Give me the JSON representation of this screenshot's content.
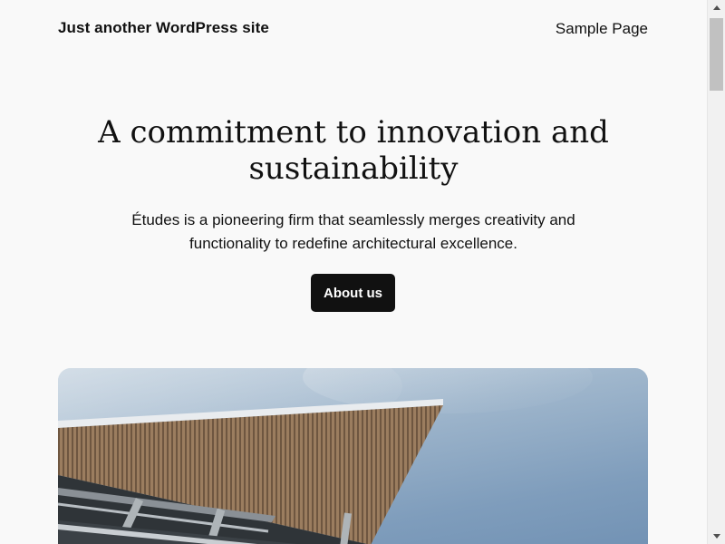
{
  "header": {
    "site_title": "Just another WordPress site",
    "nav": [
      {
        "label": "Sample Page"
      }
    ]
  },
  "hero": {
    "heading": "A commitment to innovation and sustainability",
    "text": "Études is a pioneering firm that seamlessly merges creativity and functionality to redefine architectural excellence.",
    "button_label": "About us"
  },
  "colors": {
    "background": "#f9f9f9",
    "text": "#111111",
    "button_bg": "#111111",
    "button_text": "#ffffff"
  },
  "icons": {
    "scroll_up": "triangle-up-icon",
    "scroll_down": "triangle-down-icon"
  }
}
